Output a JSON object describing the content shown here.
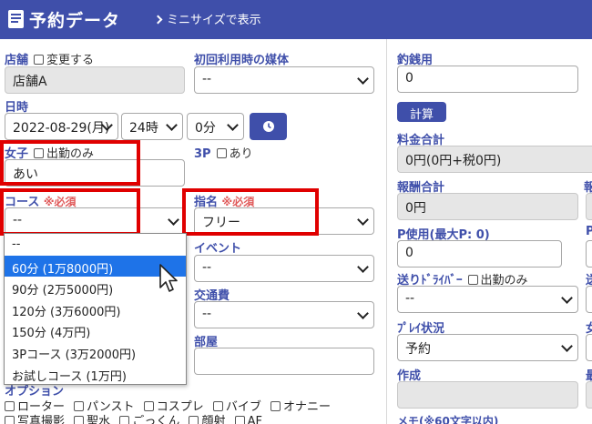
{
  "header": {
    "title": "予約データ",
    "mini_link": "ミニサイズで表示"
  },
  "store": {
    "label": "店舗",
    "checkbox_label": "変更する",
    "value": "店舗A"
  },
  "media": {
    "label": "初回利用時の媒体",
    "value": "--"
  },
  "datetime": {
    "label": "日時",
    "date": "2022-08-29(月)",
    "hour": "24時",
    "minute": "0分"
  },
  "girl": {
    "label": "女子",
    "checkbox_label": "出勤のみ",
    "value": "あい"
  },
  "threep": {
    "label": "3P",
    "checkbox_label": "あり"
  },
  "course": {
    "label": "コース",
    "required": "※必須",
    "value": "--"
  },
  "nomination": {
    "label": "指名",
    "required": "※必須",
    "value": "フリー"
  },
  "course_options": [
    "--",
    "60分 (1万8000円)",
    "90分 (2万5000円)",
    "120分 (3万6000円)",
    "150分 (4万円)",
    "3Pコース (3万2000円)",
    "お試しコース (1万円)"
  ],
  "event": {
    "label": "イベント",
    "value": "--"
  },
  "transport": {
    "label": "交通費",
    "value": "--"
  },
  "room": {
    "label": "部屋",
    "value": ""
  },
  "options": {
    "label": "オプション",
    "row1": [
      "ローター",
      "パンスト",
      "コスプレ",
      "バイブ",
      "オナニー"
    ],
    "row2": [
      "写真撮影",
      "聖水",
      "ごっくん",
      "顔射",
      "AF"
    ]
  },
  "change": {
    "label": "釣銭用",
    "value": "0"
  },
  "calc_button": "計算",
  "total": {
    "label": "料金合計",
    "value": "0円(0円+税0円)"
  },
  "reward": {
    "label": "報酬合計",
    "value": "0円"
  },
  "points": {
    "label": "P使用(最大P: 0)",
    "value": "0"
  },
  "driver": {
    "label": "送りﾄﾞﾗｲﾊﾞｰ",
    "checkbox_label": "出勤のみ",
    "value": "--"
  },
  "play_status": {
    "label": "ﾌﾟﾚｲ状況",
    "value": "予約"
  },
  "created": {
    "label": "作成",
    "value": ""
  },
  "memo": {
    "label": "メモ(※60文字以内)"
  },
  "cut_labels": [
    "報",
    "P",
    "送",
    "女",
    "最"
  ],
  "colors": {
    "header": "#3f4faa",
    "label": "#3f4faa",
    "required": "#e05a5a",
    "highlight_box": "#e00000",
    "dropdown_active": "#1e73e8"
  }
}
